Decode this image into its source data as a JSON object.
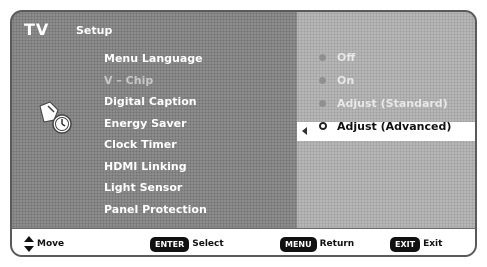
{
  "header": {
    "tv_label": "TV",
    "section": "Setup"
  },
  "menu": {
    "items": [
      {
        "label": "Menu Language",
        "state": "enabled"
      },
      {
        "label": "V – Chip",
        "state": "disabled"
      },
      {
        "label": "Digital Caption",
        "state": "enabled"
      },
      {
        "label": "Energy Saver",
        "state": "enabled"
      },
      {
        "label": "Clock Timer",
        "state": "enabled"
      },
      {
        "label": "HDMI Linking",
        "state": "enabled"
      },
      {
        "label": "Light Sensor",
        "state": "enabled"
      },
      {
        "label": "Panel Protection",
        "state": "enabled"
      }
    ]
  },
  "options": {
    "items": [
      {
        "label": "Off",
        "selected": false
      },
      {
        "label": "On",
        "selected": false
      },
      {
        "label": "Adjust (Standard)",
        "selected": false
      },
      {
        "label": "Adjust (Advanced)",
        "selected": true
      }
    ]
  },
  "footer": {
    "move_icon": "up-down-arrows-icon",
    "move_label": "Move",
    "enter_key": "ENTER",
    "enter_label": "Select",
    "menu_key": "MENU",
    "menu_label": "Return",
    "exit_key": "EXIT",
    "exit_label": "Exit"
  },
  "colors": {
    "panel_left": "#8c8c8c",
    "panel_right": "#b6b6b6",
    "highlight": "#ffffff",
    "key_badge": "#111111"
  }
}
